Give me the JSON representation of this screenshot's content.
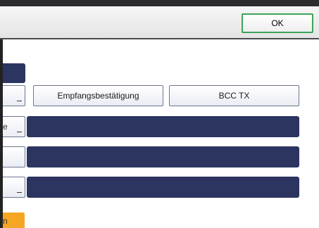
{
  "header": {
    "ok_label": "OK"
  },
  "options": {
    "receipt_label": "Empfangsbestätigung",
    "bcc_label": "BCC TX"
  },
  "rows": [
    {
      "edge_text": ""
    },
    {
      "edge_text": "e"
    },
    {
      "edge_text": ""
    },
    {
      "edge_text": ""
    }
  ],
  "bottom": {
    "edge_text": "n"
  },
  "colors": {
    "accent_dark": "#2b3560",
    "ok_border": "#3da35a",
    "orange": "#f5a623"
  }
}
